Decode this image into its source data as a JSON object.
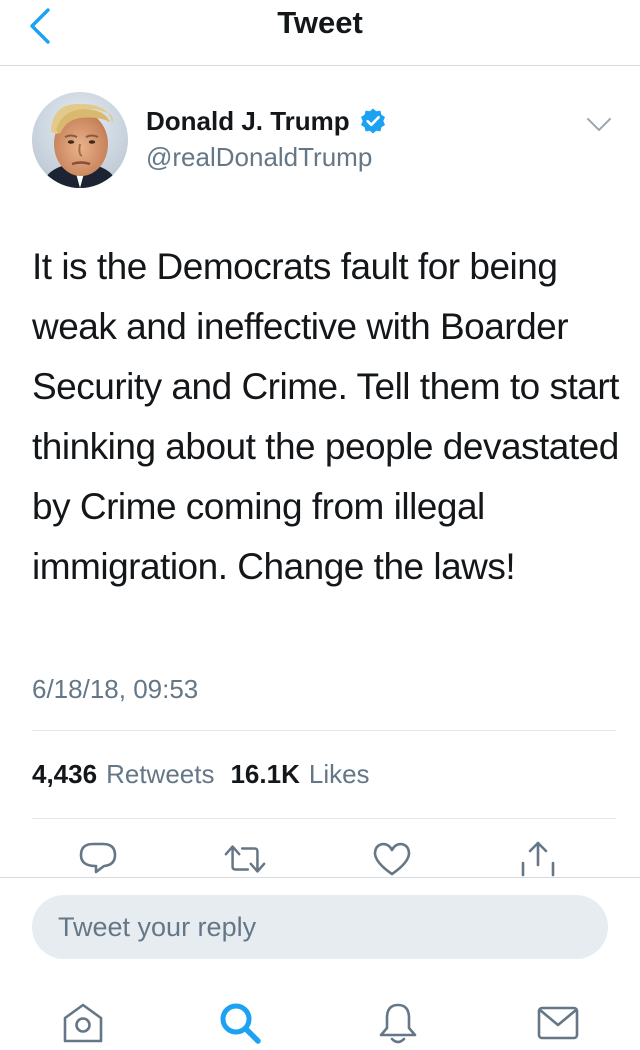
{
  "header": {
    "title": "Tweet",
    "back_icon": "chevron-left-icon"
  },
  "author": {
    "display_name": "Donald J. Trump",
    "handle": "@realDonaldTrump",
    "verified": true,
    "verified_icon": "verified-badge-icon",
    "avatar_icon": "avatar-photo",
    "menu_icon": "chevron-down-icon"
  },
  "tweet": {
    "text": "It is the Democrats fault for being weak and ineffective with Boarder Security and Crime. Tell them to start thinking about the people devastated by Crime coming from illegal immigration. Change the laws!",
    "timestamp": "6/18/18, 09:53"
  },
  "stats": {
    "retweets_count": "4,436",
    "retweets_label": "Retweets",
    "likes_count": "16.1K",
    "likes_label": "Likes"
  },
  "actions": [
    {
      "name": "reply-action",
      "icon": "reply-icon"
    },
    {
      "name": "retweet-action",
      "icon": "retweet-icon"
    },
    {
      "name": "like-action",
      "icon": "heart-icon"
    },
    {
      "name": "share-action",
      "icon": "share-icon"
    }
  ],
  "reply": {
    "placeholder": "Tweet your reply"
  },
  "tab_bar": {
    "items": [
      {
        "name": "home",
        "icon": "home-icon",
        "active": false
      },
      {
        "name": "search",
        "icon": "search-icon",
        "active": true
      },
      {
        "name": "notifications",
        "icon": "bell-icon",
        "active": false
      },
      {
        "name": "messages",
        "icon": "envelope-icon",
        "active": false
      }
    ]
  },
  "colors": {
    "accent": "#1da1f2",
    "icon_gray": "#657786",
    "text": "#14171a",
    "secondary_text": "#657786",
    "divider": "#e1e8ed",
    "input_background": "#e6ecf0"
  }
}
